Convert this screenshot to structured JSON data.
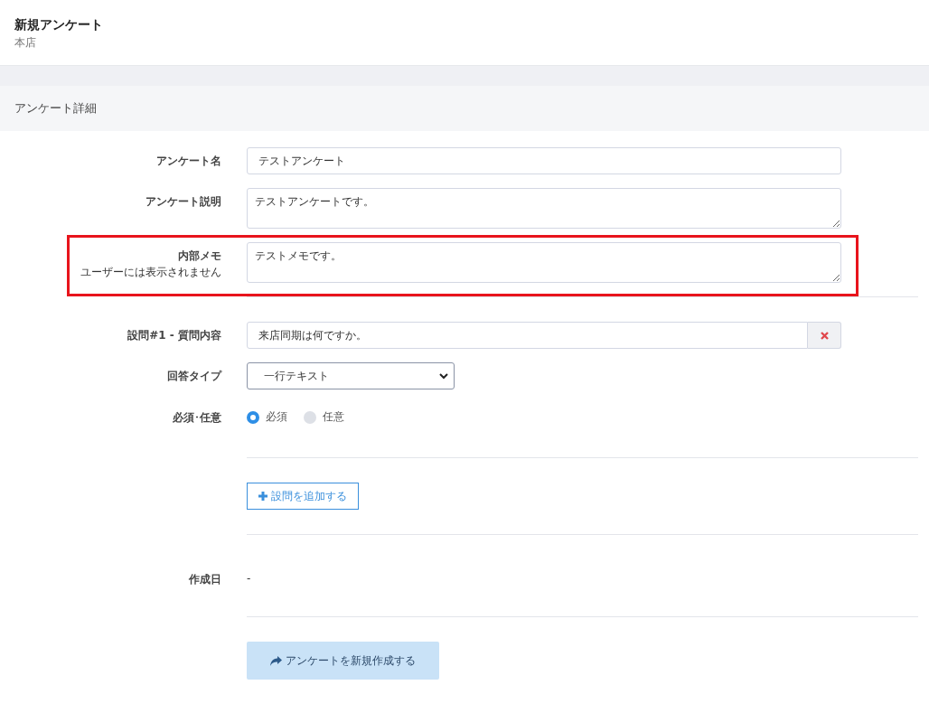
{
  "header": {
    "title": "新規アンケート",
    "subtitle": "本店"
  },
  "section": {
    "title": "アンケート詳細"
  },
  "fields": [
    {
      "kind": "input",
      "label": "アンケート名",
      "value": "テストアンケート",
      "highlighted": false
    },
    {
      "kind": "textarea",
      "label": "アンケート説明",
      "value": "テストアンケートです。",
      "highlighted": false
    },
    {
      "kind": "textarea",
      "label": "内部メモ",
      "note": "ユーザーには表示されません",
      "value": "テストメモです。",
      "highlighted": true
    }
  ],
  "question": {
    "label": "設問#1 - 質問内容",
    "value": "来店同期は何ですか。",
    "answer_type_label": "回答タイプ",
    "answer_type": "一行テキスト",
    "required_label": "必須･任意",
    "options": [
      {
        "label": "必須",
        "selected": true
      },
      {
        "label": "任意",
        "selected": false
      }
    ]
  },
  "add_button": "設問を追加する",
  "created": {
    "label": "作成日",
    "value": "-"
  },
  "submit_button": "アンケートを新規作成する"
}
